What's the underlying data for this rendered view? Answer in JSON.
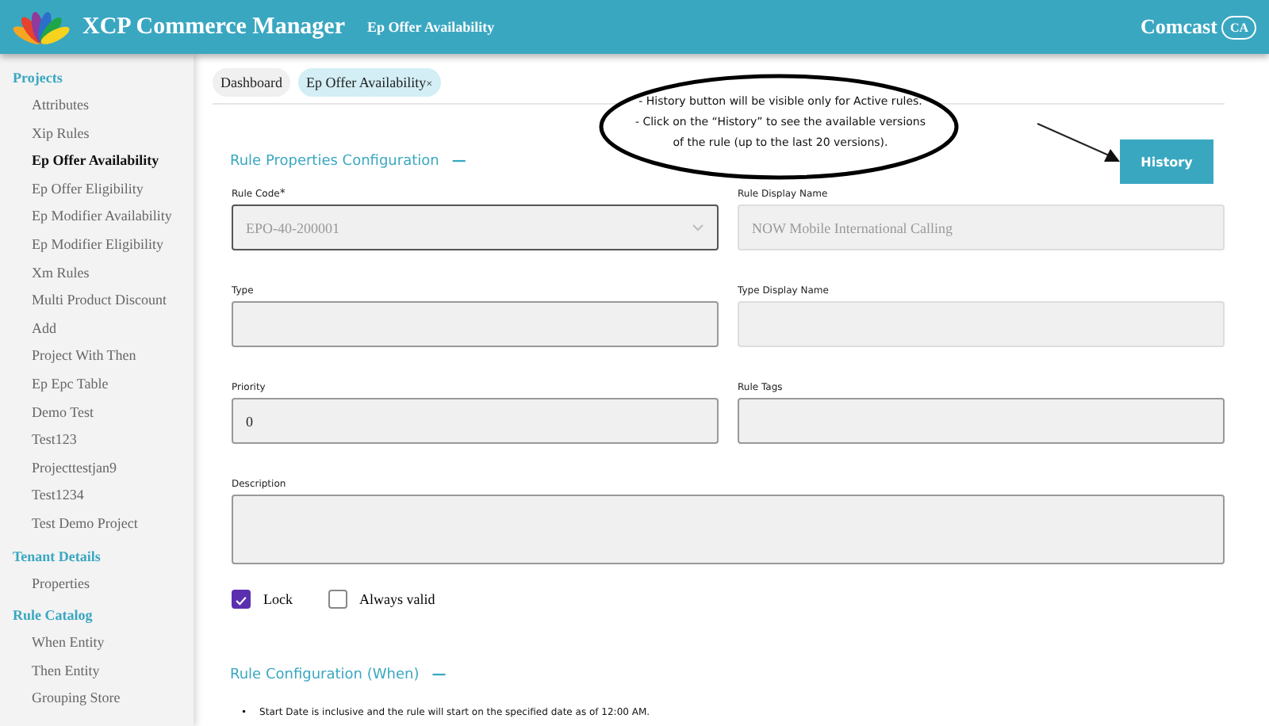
{
  "header": {
    "title": "XCP Commerce Manager",
    "page_title": "Ep Offer Availability",
    "brand": "Comcast",
    "brand_badge": "CA"
  },
  "sidebar": {
    "sections": [
      {
        "title": "Projects",
        "items": [
          {
            "label": "Attributes",
            "selected": false
          },
          {
            "label": "Xip Rules",
            "selected": false
          },
          {
            "label": "Ep Offer Availability",
            "selected": true
          },
          {
            "label": "Ep Offer Eligibility",
            "selected": false
          },
          {
            "label": "Ep Modifier Availability",
            "selected": false
          },
          {
            "label": "Ep Modifier Eligibility",
            "selected": false
          },
          {
            "label": "Xm Rules",
            "selected": false
          },
          {
            "label": "Multi Product Discount",
            "selected": false
          },
          {
            "label": "Add",
            "selected": false
          },
          {
            "label": "Project With Then",
            "selected": false
          },
          {
            "label": "Ep Epc Table",
            "selected": false
          },
          {
            "label": "Demo Test",
            "selected": false
          },
          {
            "label": "Test123",
            "selected": false
          },
          {
            "label": "Projecttestjan9",
            "selected": false
          },
          {
            "label": "Test1234",
            "selected": false
          },
          {
            "label": "Test Demo Project",
            "selected": false
          }
        ]
      },
      {
        "title": "Tenant Details",
        "items": [
          {
            "label": "Properties",
            "selected": false
          }
        ]
      },
      {
        "title": "Rule Catalog",
        "items": [
          {
            "label": "When Entity",
            "selected": false
          },
          {
            "label": "Then Entity",
            "selected": false
          },
          {
            "label": "Grouping Store",
            "selected": false
          }
        ]
      }
    ]
  },
  "tabs": [
    {
      "label": "Dashboard",
      "selected": false
    },
    {
      "label": "Ep Offer Availability",
      "selected": true,
      "close": "×"
    }
  ],
  "callout": {
    "lines": [
      "- History button will be visible only for Active rules.",
      "- Click on the “History” to see the available versions",
      "of the rule (up to the last 20 versions)."
    ]
  },
  "history_button": "History",
  "section_title": "Rule Properties Configuration",
  "section_toggle": "—",
  "fields": [
    {
      "label": "Rule Code",
      "required_mark": "*",
      "kind": "select",
      "value": "EPO-40-200001",
      "disabled": false
    },
    {
      "label": "Rule Display Name",
      "kind": "text",
      "value": "NOW Mobile International Calling",
      "disabled": true
    },
    {
      "label": "Type",
      "kind": "text",
      "disabled": false
    },
    {
      "label": "Type Display Name",
      "kind": "text",
      "disabled": true
    },
    {
      "label": "Priority",
      "kind": "text",
      "value": "0",
      "disabled": false
    },
    {
      "label": "Rule Tags",
      "kind": "text",
      "disabled": false
    },
    {
      "label": "Description",
      "kind": "textarea",
      "disabled": false
    }
  ],
  "checkboxes": [
    {
      "label": "Lock",
      "checked": true
    },
    {
      "label": "Always valid",
      "checked": false
    }
  ],
  "section2": {
    "title": "Rule Configuration (When)",
    "toggle": "—",
    "bullet_mark": "•",
    "bullets": [
      "Start Date is inclusive and the rule will start on the specified date as of 12:00 AM."
    ]
  }
}
